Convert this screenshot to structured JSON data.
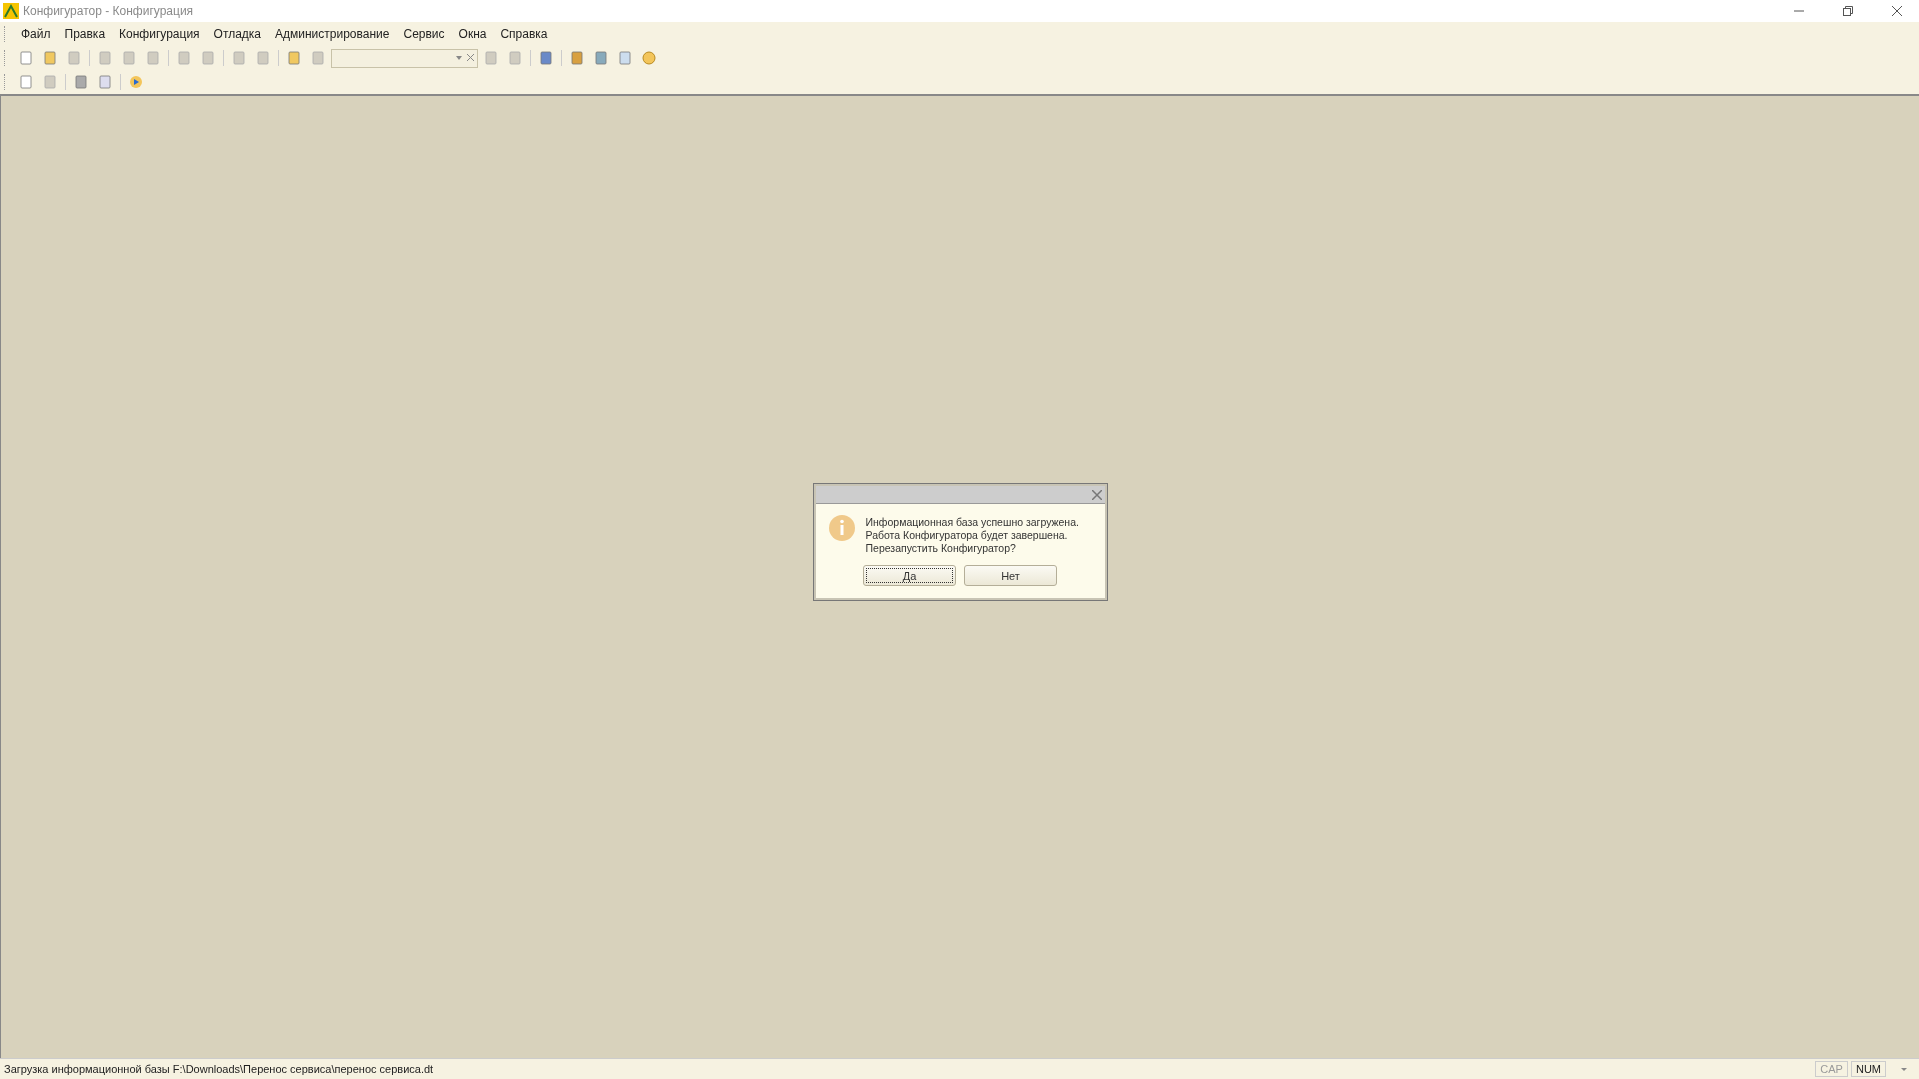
{
  "window": {
    "title": "Конфигуратор - Конфигурация"
  },
  "menu": [
    "Файл",
    "Правка",
    "Конфигурация",
    "Отладка",
    "Администрирование",
    "Сервис",
    "Окна",
    "Справка"
  ],
  "dialog": {
    "lines": [
      "Информационная база успешно загружена.",
      "Работа Конфигуратора будет завершена.",
      "Перезапустить Конфигуратор?"
    ],
    "buttons": [
      {
        "label": "Да",
        "selected": true
      },
      {
        "label": "Нет",
        "selected": false
      }
    ]
  },
  "status_bar": {
    "message": "Загрузка информационной базы F:\\Downloads\\Перенос сервиса\\перенос сервиса.dt",
    "indicators": [
      {
        "label": "CAP",
        "on": false
      },
      {
        "label": "NUM",
        "on": true
      }
    ]
  }
}
